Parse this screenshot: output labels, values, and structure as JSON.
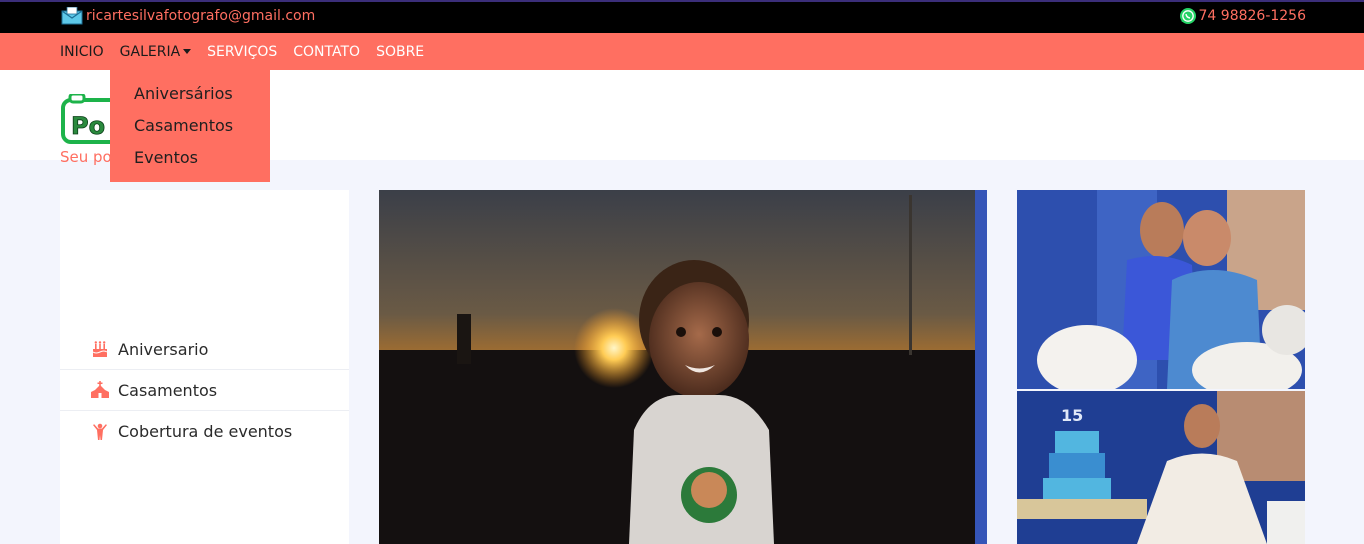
{
  "topbar": {
    "email": "ricartesilvafotografo@gmail.com",
    "phone": "74 98826-1256"
  },
  "nav": {
    "items": [
      {
        "label": "INICIO"
      },
      {
        "label": "GALERIA"
      },
      {
        "label": "SERVIÇOS"
      },
      {
        "label": "CONTATO"
      },
      {
        "label": "SOBRE"
      }
    ]
  },
  "dropdown": {
    "items": [
      {
        "label": "Aniversários"
      },
      {
        "label": "Casamentos"
      },
      {
        "label": "Eventos"
      }
    ]
  },
  "header": {
    "tagline": "Seu po"
  },
  "sidebar": {
    "items": [
      {
        "label": "Aniversario",
        "icon": "cake-icon"
      },
      {
        "label": "Casamentos",
        "icon": "church-icon"
      },
      {
        "label": "Cobertura de eventos",
        "icon": "person-celebrating-icon"
      }
    ]
  },
  "colors": {
    "accent": "#ff6f61",
    "topbar": "#000000",
    "page_bg": "#f3f5fd"
  }
}
